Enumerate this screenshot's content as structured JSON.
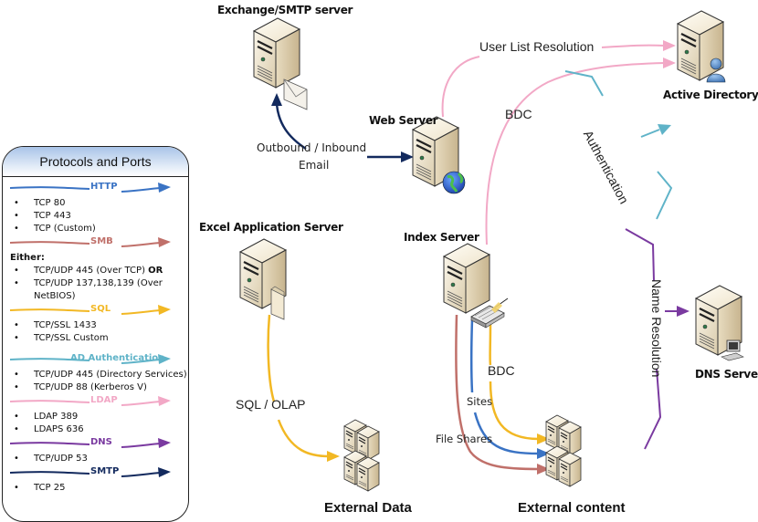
{
  "legend": {
    "title": "Protocols and Ports",
    "protocols": [
      {
        "name": "HTTP",
        "color": "#3a73c4",
        "note": "",
        "items": [
          "TCP 80",
          "TCP 443",
          "TCP (Custom)"
        ]
      },
      {
        "name": "SMB",
        "color": "#c0706a",
        "note": "Either:",
        "items": [
          "TCP/UDP 445 (Over TCP) OR",
          "TCP/UDP 137,138,139 (Over NetBIOS)"
        ]
      },
      {
        "name": "SQL",
        "color": "#f2b824",
        "note": "",
        "items": [
          "TCP/SSL 1433",
          "TCP/SSL  Custom"
        ]
      },
      {
        "name": "AD Authentication",
        "color": "#5fb3c8",
        "note": "",
        "items": [
          "TCP/UDP 445 (Directory Services)",
          "TCP/UDP 88 (Kerberos V)"
        ]
      },
      {
        "name": "LDAP",
        "color": "#f2a8c6",
        "note": "",
        "items": [
          "LDAP 389",
          "LDAPS 636"
        ]
      },
      {
        "name": "DNS",
        "color": "#7a3aa0",
        "note": "",
        "items": [
          "TCP/UDP 53"
        ]
      },
      {
        "name": "SMTP",
        "color": "#132a5e",
        "note": "",
        "items": [
          "TCP 25"
        ]
      }
    ]
  },
  "nodes": {
    "exchange": {
      "label": "Exchange/SMTP server",
      "badge": "envelope"
    },
    "web": {
      "label": "Web Server",
      "badge": "globe"
    },
    "active_directory": {
      "label": "Active Directory",
      "badge": "user"
    },
    "excel": {
      "label": "Excel Application Server",
      "badge": "document"
    },
    "index": {
      "label": "Index Server",
      "badge": "network-switch"
    },
    "dns": {
      "label": "DNS Server",
      "badge": "workstation"
    },
    "external_data": {
      "label": "External Data"
    },
    "external_content": {
      "label": "External content"
    }
  },
  "connections": {
    "email": {
      "label_line1": "Outbound / Inbound",
      "label_line2": "Email",
      "protocol": "SMTP"
    },
    "user_list": {
      "label": "User List Resolution",
      "protocol": "LDAP"
    },
    "bdc_top": {
      "label": "BDC",
      "protocol": "LDAP"
    },
    "authentication": {
      "label": "Authentication",
      "protocol": "AD Authentication"
    },
    "name_resolution": {
      "label": "Name Resolution",
      "protocol": "DNS"
    },
    "sql_olap": {
      "label": "SQL / OLAP",
      "protocol": "SQL"
    },
    "bdc_bottom": {
      "label": "BDC",
      "protocol": "SQL"
    },
    "sites": {
      "label": "Sites",
      "protocol": "HTTP"
    },
    "file_shares": {
      "label": "File Shares",
      "protocol": "SMB"
    }
  }
}
